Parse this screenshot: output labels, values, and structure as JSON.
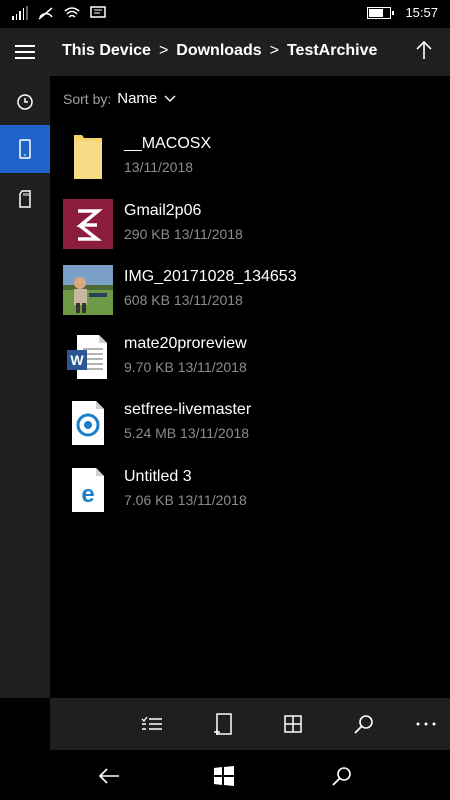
{
  "status": {
    "time": "15:57"
  },
  "breadcrumb": {
    "root": "This Device",
    "folder": "Downloads",
    "current": "TestArchive",
    "separator": ">"
  },
  "sort": {
    "label": "Sort by:",
    "value": "Name"
  },
  "files": [
    {
      "name": "__MACOSX",
      "meta": "13/11/2018",
      "icon": "folder-icon"
    },
    {
      "name": "Gmail2p06",
      "meta": "290 KB 13/11/2018",
      "icon": "zip-app-icon"
    },
    {
      "name": "IMG_20171028_134653",
      "meta": "608 KB 13/11/2018",
      "icon": "photo-thumbnail"
    },
    {
      "name": "mate20proreview",
      "meta": "9.70 KB 13/11/2018",
      "icon": "word-document-icon"
    },
    {
      "name": "setfree-livemaster",
      "meta": "5.24 MB 13/11/2018",
      "icon": "media-file-icon"
    },
    {
      "name": "Untitled 3",
      "meta": "7.06 KB 13/11/2018",
      "icon": "edge-html-icon"
    }
  ],
  "colors": {
    "accent": "#1e64c8",
    "panel": "#1f1f1f",
    "secondary_text": "#8c8c8c",
    "folder": "#f6d36b",
    "zip": "#8b1c3d"
  },
  "toolbar_icons": [
    "select-icon",
    "new-folder-icon",
    "tiles-view-icon",
    "search-icon",
    "more-icon"
  ],
  "nav_icons": [
    "back-icon",
    "windows-icon",
    "search-icon"
  ]
}
